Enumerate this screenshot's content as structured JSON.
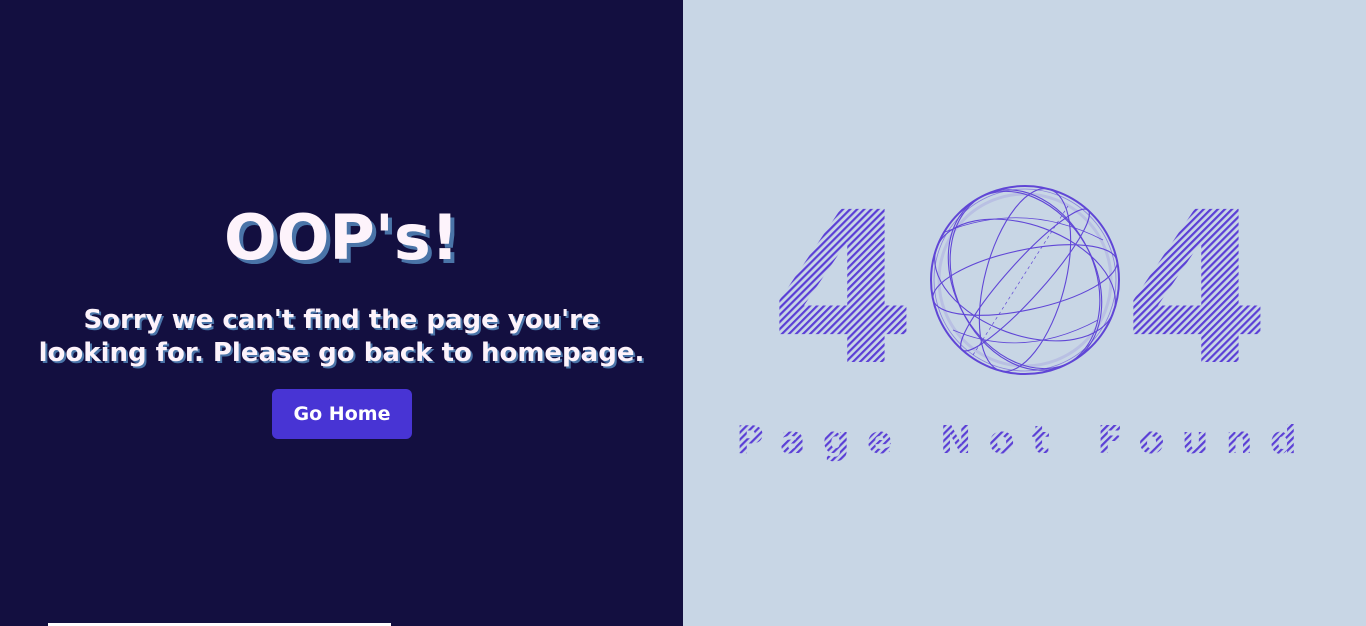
{
  "error_page": {
    "title": "OOP's!",
    "message_line1": "Sorry we can't find the page you're",
    "message_line2": "looking for. Please go back to homepage.",
    "home_button_label": "Go Home",
    "code_digit_left": "4",
    "code_digit_right": "4",
    "subtitle": "Page Not Found"
  },
  "colors": {
    "left_bg": "#130f40",
    "right_bg": "#c8d6e5",
    "accent": "#4834d4",
    "stripe": "#5b3fd6",
    "text": "#fdf3fb",
    "text_shadow": "#4a74a8"
  },
  "icons": {
    "globe": "wireframe-globe-icon"
  }
}
